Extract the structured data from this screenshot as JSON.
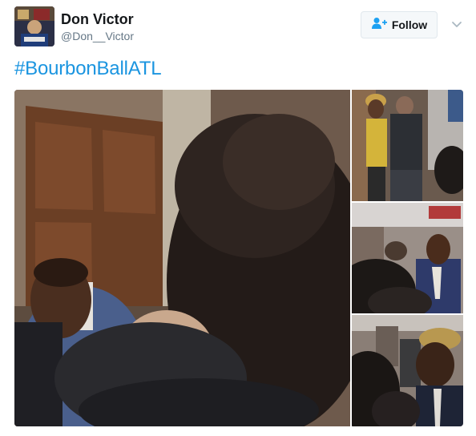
{
  "author": {
    "name": "Don Victor",
    "handle": "@Don__Victor"
  },
  "header": {
    "follow_label": "Follow"
  },
  "tweet": {
    "hashtag": "#BourbonBallATL"
  },
  "icons": {
    "follow": "add-user-icon",
    "menu": "chevron-down-icon"
  },
  "colors": {
    "link": "#1b95e0",
    "name": "#14171a",
    "handle": "#657786",
    "follow_icon": "#1da1f2"
  }
}
